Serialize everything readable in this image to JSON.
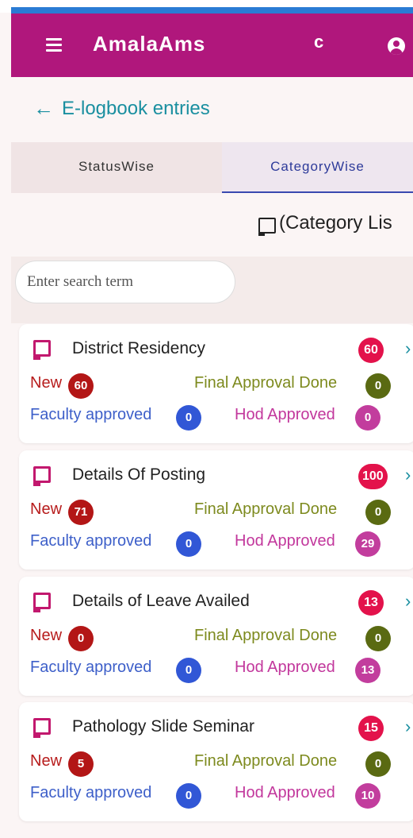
{
  "app": {
    "title": "AmalaAms"
  },
  "header": {
    "title": "E-logbook entries"
  },
  "tabs": [
    {
      "label": "StatusWise"
    },
    {
      "label": "CategoryWise"
    }
  ],
  "section": {
    "title": "(Category Lis"
  },
  "search": {
    "placeholder": "Enter search term"
  },
  "labels": {
    "new": "New",
    "final": "Final Approval Done",
    "faculty": "Faculty approved",
    "hod": "Hod Approved"
  },
  "cards": [
    {
      "title": "District Residency",
      "total": "60",
      "new": "60",
      "final": "0",
      "faculty": "0",
      "hod": "0"
    },
    {
      "title": "Details Of Posting",
      "total": "100",
      "new": "71",
      "final": "0",
      "faculty": "0",
      "hod": "29"
    },
    {
      "title": "Details of Leave Availed",
      "total": "13",
      "new": "0",
      "final": "0",
      "faculty": "0",
      "hod": "13"
    },
    {
      "title": "Pathology Slide Seminar",
      "total": "15",
      "new": "5",
      "final": "0",
      "faculty": "0",
      "hod": "10"
    }
  ],
  "icons": {
    "menu": "menu-icon",
    "refresh": "refresh-icon",
    "user": "user-icon",
    "back": "back-arrow-icon",
    "category": "book-icon",
    "chevron": "chevron-right-icon"
  },
  "colors": {
    "appbar": "#b0177c",
    "accent": "#1a8fa0",
    "tab_active": "#3a49b0",
    "total_badge": "#e3124b",
    "new": "#b31616",
    "final": "#5a6a12",
    "faculty": "#3157d6",
    "hod": "#c23d9d"
  }
}
